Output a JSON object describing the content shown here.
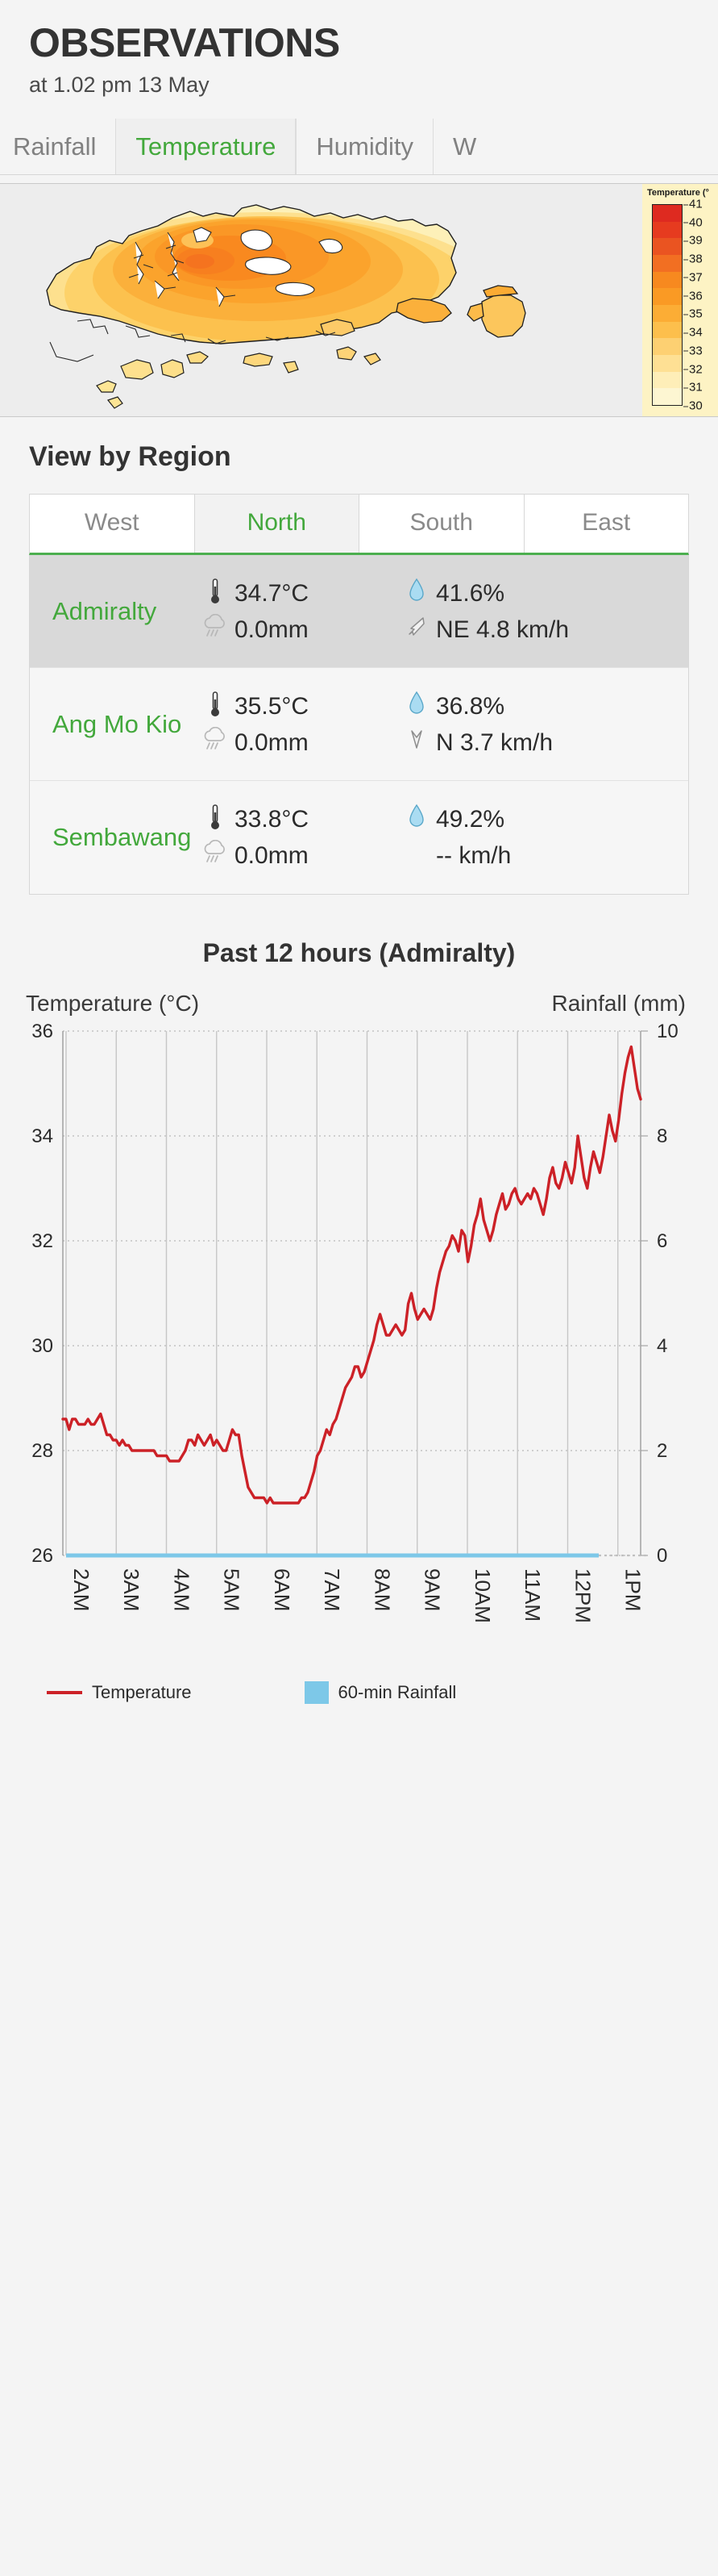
{
  "header": {
    "title": "OBSERVATIONS",
    "subtitle": "at 1.02 pm 13 May"
  },
  "param_tabs": [
    {
      "label": "Rainfall",
      "active": false
    },
    {
      "label": "Temperature",
      "active": true
    },
    {
      "label": "Humidity",
      "active": false
    },
    {
      "label": "W",
      "active": false
    }
  ],
  "map": {
    "legend_title": "Temperature (°",
    "legend_ticks": [
      "41",
      "40",
      "39",
      "38",
      "37",
      "36",
      "35",
      "34",
      "33",
      "32",
      "31",
      "30"
    ],
    "legend_colors": [
      "#de2a20",
      "#e63b1f",
      "#ea5421",
      "#f26f22",
      "#f7891f",
      "#fa9a24",
      "#fcad35",
      "#fdbf4c",
      "#fdd072",
      "#fee094",
      "#feeeb8",
      "#fdf6d2"
    ],
    "legend_min": 30,
    "legend_max": 41
  },
  "region_section": {
    "title": "View by Region",
    "tabs": [
      {
        "label": "West",
        "active": false
      },
      {
        "label": "North",
        "active": true
      },
      {
        "label": "South",
        "active": false
      },
      {
        "label": "East",
        "active": false
      }
    ]
  },
  "stations": [
    {
      "name": "Admiralty",
      "temperature": "34.7°C",
      "rainfall": "0.0mm",
      "humidity": "41.6%",
      "wind": "NE 4.8 km/h",
      "wind_available": true,
      "highlight": true
    },
    {
      "name": "Ang Mo Kio",
      "temperature": "35.5°C",
      "rainfall": "0.0mm",
      "humidity": "36.8%",
      "wind": "N 3.7 km/h",
      "wind_available": true,
      "highlight": false
    },
    {
      "name": "Sembawang",
      "temperature": "33.8°C",
      "rainfall": "0.0mm",
      "humidity": "49.2%",
      "wind": "-- km/h",
      "wind_available": false,
      "highlight": false
    }
  ],
  "icons": {
    "thermometer": "thermometer-icon",
    "rain_cloud": "rain-cloud-icon",
    "droplet": "water-droplet-icon",
    "wind_arrow": "wind-direction-arrow-icon"
  },
  "chart_panel": {
    "title": "Past 12 hours (Admiralty)",
    "left_axis_caption": "Temperature (°C)",
    "right_axis_caption": "Rainfall (mm)",
    "legend": [
      {
        "label": "Temperature",
        "color": "#cc2127",
        "marker": "line"
      },
      {
        "label": "60-min Rainfall",
        "color": "#7dc8e8",
        "marker": "square"
      }
    ]
  },
  "chart_data": {
    "type": "line",
    "title": "Past 12 hours (Admiralty)",
    "xlabel": "",
    "ylabel": "Temperature (°C)",
    "y2label": "Rainfall (mm)",
    "ylim": [
      26,
      36
    ],
    "y2lim": [
      0,
      10
    ],
    "yticks": [
      26,
      28,
      30,
      32,
      34,
      36
    ],
    "y2ticks": [
      0,
      2,
      4,
      6,
      8,
      10
    ],
    "grid": true,
    "legend_position": "bottom-left",
    "x": [
      "2AM",
      "3AM",
      "4AM",
      "5AM",
      "6AM",
      "7AM",
      "8AM",
      "9AM",
      "10AM",
      "11AM",
      "12PM",
      "1PM"
    ],
    "xticklabel_rotation": 90,
    "series": [
      {
        "name": "Temperature",
        "axis": "left",
        "color": "#cc2127",
        "units": "°C",
        "sample_interval_minutes": 5,
        "values": [
          28.6,
          28.6,
          28.4,
          28.6,
          28.6,
          28.5,
          28.5,
          28.5,
          28.6,
          28.5,
          28.5,
          28.6,
          28.7,
          28.5,
          28.3,
          28.3,
          28.2,
          28.2,
          28.1,
          28.2,
          28.1,
          28.1,
          28.0,
          28.0,
          28.0,
          28.0,
          28.0,
          28.0,
          28.0,
          28.0,
          27.9,
          27.9,
          27.9,
          27.9,
          27.8,
          27.8,
          27.8,
          27.8,
          27.9,
          28.0,
          28.2,
          28.2,
          28.1,
          28.3,
          28.2,
          28.1,
          28.2,
          28.3,
          28.1,
          28.2,
          28.1,
          28.0,
          28.0,
          28.2,
          28.4,
          28.3,
          28.3,
          27.9,
          27.6,
          27.3,
          27.2,
          27.1,
          27.1,
          27.1,
          27.1,
          27.0,
          27.1,
          27.0,
          27.0,
          27.0,
          27.0,
          27.0,
          27.0,
          27.0,
          27.0,
          27.0,
          27.1,
          27.1,
          27.2,
          27.4,
          27.6,
          27.9,
          28.0,
          28.2,
          28.4,
          28.3,
          28.5,
          28.6,
          28.8,
          29.0,
          29.2,
          29.3,
          29.4,
          29.6,
          29.6,
          29.4,
          29.5,
          29.7,
          29.9,
          30.1,
          30.4,
          30.6,
          30.4,
          30.2,
          30.2,
          30.3,
          30.4,
          30.3,
          30.2,
          30.3,
          30.8,
          31.0,
          30.7,
          30.5,
          30.6,
          30.7,
          30.6,
          30.5,
          30.7,
          31.1,
          31.4,
          31.6,
          31.8,
          31.9,
          32.1,
          32.0,
          31.8,
          32.2,
          32.1,
          31.6,
          31.9,
          32.3,
          32.5,
          32.8,
          32.4,
          32.2,
          32.0,
          32.2,
          32.5,
          32.7,
          32.9,
          32.6,
          32.7,
          32.9,
          33.0,
          32.8,
          32.7,
          32.8,
          32.9,
          32.8,
          33.0,
          32.9,
          32.7,
          32.5,
          32.8,
          33.2,
          33.4,
          33.1,
          33.0,
          33.2,
          33.5,
          33.3,
          33.1,
          33.4,
          34.0,
          33.6,
          33.2,
          33.0,
          33.4,
          33.7,
          33.5,
          33.3,
          33.6,
          34.0,
          34.4,
          34.1,
          33.9,
          34.3,
          34.8,
          35.2,
          35.5,
          35.7,
          35.3,
          34.9,
          34.7
        ]
      },
      {
        "name": "60-min Rainfall",
        "axis": "right",
        "color": "#7dc8e8",
        "units": "mm",
        "constant_value": 0,
        "values": [
          0,
          0,
          0,
          0,
          0,
          0,
          0,
          0,
          0,
          0,
          0,
          0
        ]
      }
    ]
  }
}
